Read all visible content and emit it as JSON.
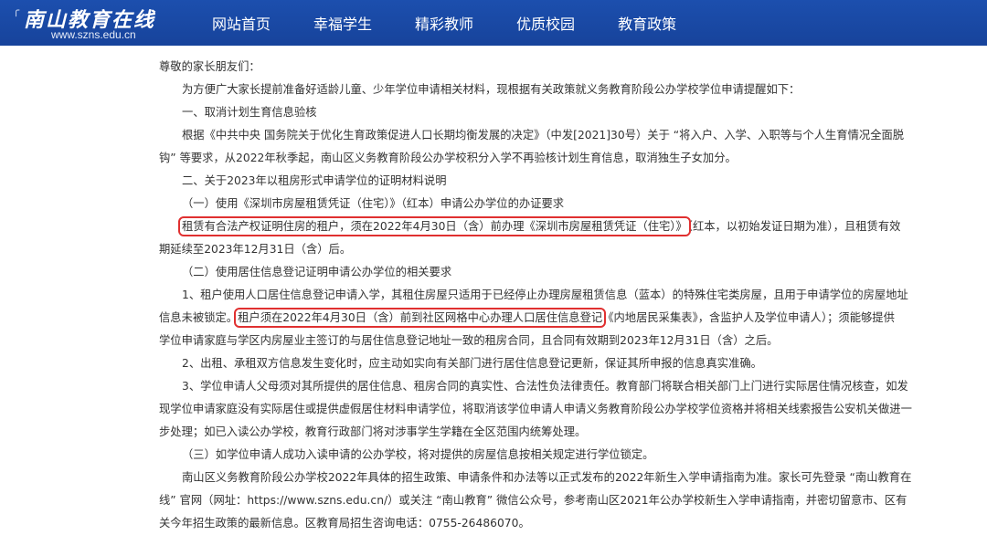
{
  "header": {
    "logo_title": "南山教育在线",
    "logo_url": "www.szns.edu.cn",
    "nav": [
      {
        "label": "网站首页"
      },
      {
        "label": "幸福学生"
      },
      {
        "label": "精彩教师"
      },
      {
        "label": "优质校园"
      },
      {
        "label": "教育政策"
      }
    ]
  },
  "article": {
    "greeting": "尊敬的家长朋友们：",
    "intro": "为方便广大家长提前准备好适龄儿童、少年学位申请相关材料，现根据有关政策就义务教育阶段公办学校学位申请提醒如下：",
    "s1_title": "一、取消计划生育信息验核",
    "s1_p1_a": "根据《中共中央 国务院关于优化生育政策促进人口长期均衡发展的决定》（中发[2021]30号）关于 “将入户、入学、入职等与个人生育情况全面脱",
    "s1_p1_b": "钩” 等要求，从2022年秋季起，南山区义务教育阶段公办学校积分入学不再验核计划生育信息，取消独生子女加分。",
    "s2_title": "二、关于2023年以租房形式申请学位的证明材料说明",
    "s2_sub1": "（一）使用《深圳市房屋租赁凭证（住宅）》（红本）申请公办学位的办证要求",
    "s2_p1_hl": "租赁有合法产权证明住房的租户，须在2022年4月30日（含）前办理《深圳市房屋租赁凭证（住宅）》",
    "s2_p1_rest": "（红本，以初始发证日期为准），且租赁有效",
    "s2_p1_b": "期延续至2023年12月31日（含）后。",
    "s2_sub2": "（二）使用居住信息登记证明申请公办学位的相关要求",
    "s2_p2_a": "1、租户使用人口居住信息登记申请入学，其租住房屋只适用于已经停止办理房屋租赁信息（蓝本）的特殊住宅类房屋，且用于申请学位的房屋地址",
    "s2_p2_b_pre": "信息未被锁定。",
    "s2_p2_b_hl": "租户须在2022年4月30日（含）前到社区网格中心办理人口居住信息登记",
    "s2_p2_b_post": "《内地居民采集表》，含监护人及学位申请人）；须能够提供",
    "s2_p2_c": "学位申请家庭与学区内房屋业主签订的与居住信息登记地址一致的租房合同，且合同有效期到2023年12月31日（含）之后。",
    "s2_p3": "2、出租、承租双方信息发生变化时，应主动如实向有关部门进行居住信息登记更新，保证其所申报的信息真实准确。",
    "s2_p4_a": "3、学位申请人父母须对其所提供的居住信息、租房合同的真实性、合法性负法律责任。教育部门将联合相关部门上门进行实际居住情况核查，如发",
    "s2_p4_b": "现学位申请家庭没有实际居住或提供虚假居住材料申请学位，将取消该学位申请人申请义务教育阶段公办学校学位资格并将相关线索报告公安机关做进一",
    "s2_p4_c": "步处理；如已入读公办学校，教育行政部门将对涉事学生学籍在全区范围内统筹处理。",
    "s2_sub3": "（三）如学位申请人成功入读申请的公办学校，将对提供的房屋信息按相关规定进行学位锁定。",
    "s3_p_a": "南山区义务教育阶段公办学校2022年具体的招生政策、申请条件和办法等以正式发布的2022年新生入学申请指南为准。家长可先登录 “南山教育在",
    "s3_p_b": "线” 官网（网址：https://www.szns.edu.cn/）或关注 “南山教育” 微信公众号，参考南山区2021年公办学校新生入学申请指南，并密切留意市、区有",
    "s3_p_c": "关今年招生政策的最新信息。区教育局招生咨询电话：0755-26486070。"
  },
  "colors": {
    "header_bg": "#1a4aa5",
    "highlight_border": "#e03030",
    "text": "#333333"
  }
}
